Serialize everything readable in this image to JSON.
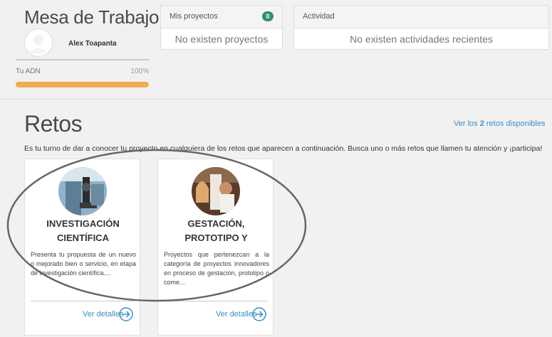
{
  "header": {
    "title": "Mesa de Trabajo",
    "user_name": "Alex Toapanta",
    "adn_label": "Tu ADN",
    "adn_percent": "100%",
    "adn_progress": 1.0
  },
  "projects": {
    "title": "Mis proyectos",
    "count": "0",
    "empty_text": "No existen proyectos"
  },
  "activity": {
    "title": "Actividad",
    "empty_text": "No existen actividades recientes"
  },
  "retos": {
    "title": "Retos",
    "see_all_prefix": "Ver los",
    "see_all_count": "2",
    "see_all_suffix": "retos disponibles",
    "intro": "Es tu turno de dar a conocer tu proyecto en cualquiera de los retos que aparecen a continuación. Busca uno o más retos que llamen tu atención y ¡participa!",
    "cards": [
      {
        "title": "INVESTIGACIÓN CIENTÍFICA",
        "description": "Presenta tu propuesta de un nuevo o mejorado bien o servicio, en etapa de investigación científica....",
        "link": "Ver detalles"
      },
      {
        "title": "GESTACIÓN, PROTOTIPO Y",
        "description": "Proyectos que pertenezcan a la categoría de proyectos innovadores en proceso de gestación, prototipo o come...",
        "link": "Ver detalles"
      }
    ]
  },
  "colors": {
    "accent_blue": "#3a8fc7",
    "progress_orange": "#f0ac52",
    "badge_green": "#2f8f7a"
  }
}
